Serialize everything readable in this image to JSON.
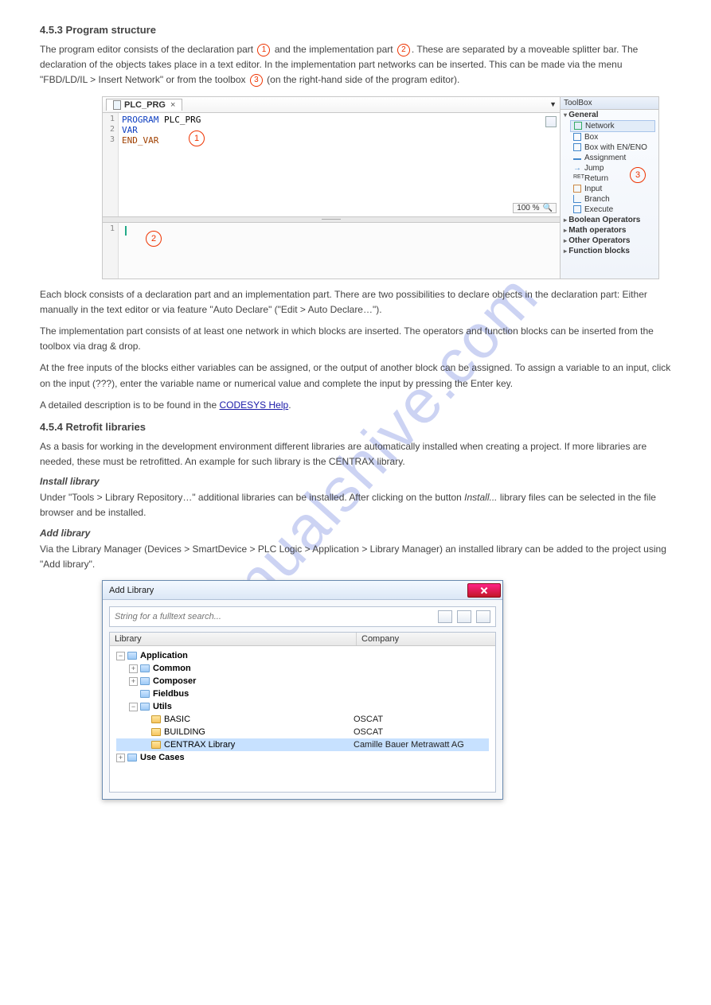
{
  "watermark": "manualshive.com",
  "intro_title": "4.5.3 Program structure",
  "intro_p1_a": "The program editor consists of the declaration part ",
  "intro_p1_b": " and the implementation part ",
  "intro_p1_c": ". These are separated by a moveable splitter bar. The declaration of the objects takes place in a text editor. In the implementation part networks can be inserted. This can be made via the menu \"FBD/LD/IL > Insert Network\" or from the toolbox ",
  "intro_p1_d": " (on the right-hand side of the program editor).",
  "tab": {
    "name": "PLC_PRG"
  },
  "code": {
    "l1": {
      "kw": "PROGRAM",
      "id": "PLC_PRG"
    },
    "l2": "VAR",
    "l3": "END_VAR"
  },
  "zoom": "100 %",
  "toolbox": {
    "title": "ToolBox",
    "cat_general": "General",
    "items": [
      "Network",
      "Box",
      "Box with EN/ENO",
      "Assignment",
      "Jump",
      "Return",
      "Input",
      "Branch",
      "Execute"
    ],
    "cats": [
      "Boolean Operators",
      "Math operators",
      "Other Operators",
      "Function blocks"
    ]
  },
  "annot": {
    "a1": "1",
    "a2": "2",
    "a3": "3"
  },
  "mid_p": "Each block consists of a declaration part and an implementation part. There are two possibilities to declare objects in the declaration part: Either manually in the text editor or via feature \"Auto Declare\" (\"Edit > Auto Declare…\").",
  "mid_p2": "The implementation part consists of at least one network in which blocks are inserted. The operators and function blocks can be inserted from the toolbox via drag & drop.",
  "mid_p3a": "At the free inputs of the blocks either variables can be assigned, or the output of another block can be assigned. To assign a variable to an input, click on the input (???), enter the variable name or numerical value and complete the input by pressing the Enter key.",
  "mid_p3b_prefix": "A detailed description is to be found in the ",
  "mid_p3b_link": "CODESYS Help",
  "mid_p3b_suffix": ".",
  "lib_title": "4.5.4 Retrofit libraries",
  "lib_p": "As a basis for working in the development environment different libraries are automatically installed when creating a project. If more libraries are needed, these must be retrofitted. An example for such library is the CENTRAX library.",
  "lib_sub": "Install library",
  "lib_p2_a": "Under \"Tools > Library Repository…\" additional libraries can be installed. After clicking on the button ",
  "lib_p2_b_italic": "Install...",
  "lib_p2_c": " library files can be selected in the file browser and be installed.",
  "lib_sub2": "Add library",
  "lib_p3": "Via the Library Manager (Devices > SmartDevice > PLC Logic > Application > Library Manager) an installed library can be added to the project using \"Add library\".",
  "dialog": {
    "title": "Add Library",
    "search_placeholder": "String for a fulltext search...",
    "col_library": "Library",
    "col_company": "Company",
    "tree": {
      "application": "Application",
      "common": "Common",
      "composer": "Composer",
      "fieldbus": "Fieldbus",
      "utils": "Utils",
      "basic": "BASIC",
      "building": "BUILDING",
      "centrax": "CENTRAX Library",
      "usecases": "Use Cases",
      "oscat": "OSCAT",
      "cbm": "Camille Bauer Metrawatt AG"
    }
  }
}
